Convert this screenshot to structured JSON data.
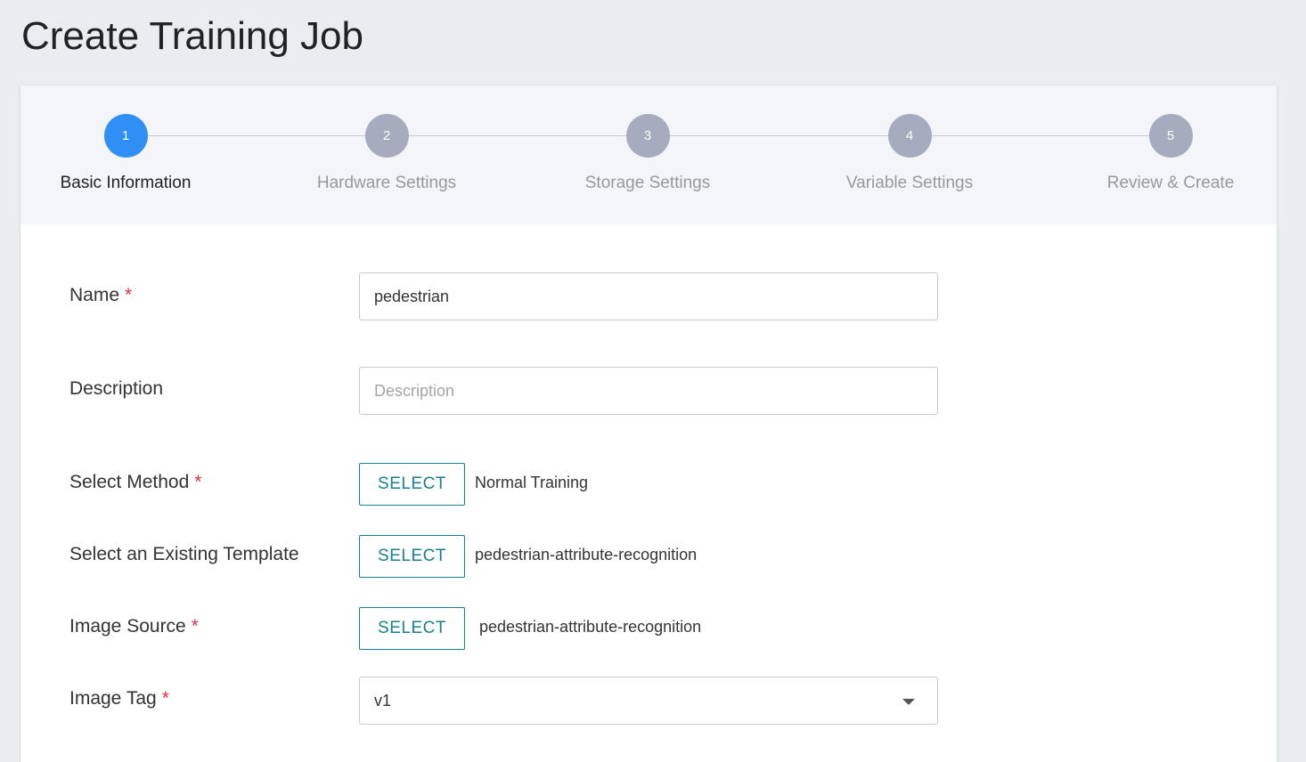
{
  "page": {
    "title": "Create Training Job"
  },
  "stepper": {
    "steps": [
      {
        "number": "1",
        "label": "Basic Information"
      },
      {
        "number": "2",
        "label": "Hardware Settings"
      },
      {
        "number": "3",
        "label": "Storage Settings"
      },
      {
        "number": "4",
        "label": "Variable Settings"
      },
      {
        "number": "5",
        "label": "Review & Create"
      }
    ],
    "active_step": 1
  },
  "form": {
    "name": {
      "label": "Name",
      "required_mark": "*",
      "value": "pedestrian"
    },
    "description": {
      "label": "Description",
      "value": "",
      "placeholder": "Description"
    },
    "select_method": {
      "label": "Select Method",
      "required_mark": "*",
      "button_label": "SELECT",
      "value": "Normal Training"
    },
    "existing_template": {
      "label": "Select an Existing Template",
      "button_label": "SELECT",
      "value": "pedestrian-attribute-recognition"
    },
    "image_source": {
      "label": "Image Source",
      "required_mark": "*",
      "button_label": "SELECT",
      "value": "pedestrian-attribute-recognition"
    },
    "image_tag": {
      "label": "Image Tag",
      "required_mark": "*",
      "value": "v1"
    }
  },
  "colors": {
    "accent": "#2f8ff5",
    "inactive_step": "#a6abbd",
    "select_button": "#1a7f8e",
    "required": "#e0323b"
  },
  "icons": {
    "dropdown": "caret-down-icon"
  }
}
